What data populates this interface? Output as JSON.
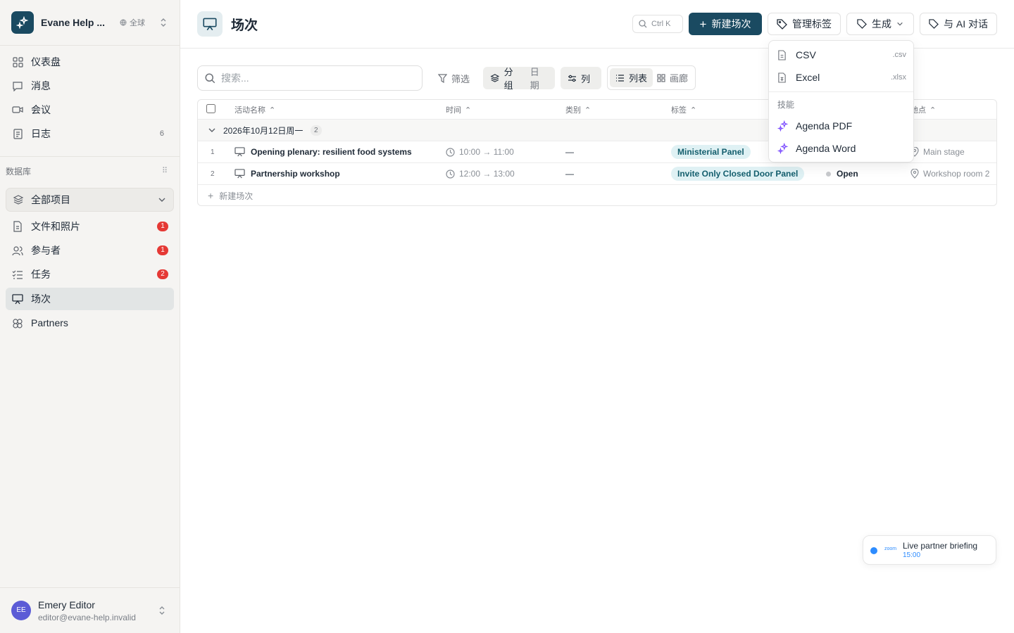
{
  "workspace": {
    "name": "Evane Help ...",
    "scope": "全球"
  },
  "nav": {
    "dashboard": "仪表盘",
    "messages": "消息",
    "meetings": "会议",
    "journal": "日志",
    "journal_count": "6"
  },
  "database": {
    "label": "数据库",
    "selector": "全部项目",
    "items": [
      {
        "label": "文件和照片",
        "badge": "1"
      },
      {
        "label": "参与者",
        "badge": "1"
      },
      {
        "label": "任务",
        "badge": "2"
      },
      {
        "label": "场次",
        "badge": ""
      },
      {
        "label": "Partners",
        "badge": ""
      }
    ]
  },
  "user": {
    "initials": "EE",
    "name": "Emery Editor",
    "email": "editor@evane-help.invalid"
  },
  "header": {
    "title": "场次",
    "shortcut": "Ctrl K",
    "new_button": "新建场次",
    "tags_button": "管理标签",
    "generate_button": "生成",
    "ai_button": "与 AI 对话"
  },
  "generate_menu": {
    "items": [
      {
        "label": "CSV",
        "suffix": ".csv"
      },
      {
        "label": "Excel",
        "suffix": ".xlsx"
      }
    ],
    "group_label": "技能",
    "skills": [
      {
        "label": "Agenda PDF"
      },
      {
        "label": "Agenda Word"
      }
    ]
  },
  "toolbar": {
    "search_placeholder": "搜索...",
    "filter": "筛选",
    "group": "分组",
    "group_value": "日期",
    "columns": "列",
    "view_list": "列表",
    "view_gallery": "画廊"
  },
  "table": {
    "columns": {
      "name": "活动名称",
      "time": "时间",
      "category": "类别",
      "tags": "标签",
      "location": "地点"
    },
    "group": {
      "label": "2026年10月12日周一",
      "count": "2"
    },
    "rows": [
      {
        "num": "1",
        "name": "Opening plenary: resilient food systems",
        "time": "10:00 → 11:00",
        "category": "—",
        "tag": "Ministerial Panel",
        "status": "",
        "location": "Main stage"
      },
      {
        "num": "2",
        "name": "Partnership workshop",
        "time": "12:00 → 13:00",
        "category": "—",
        "tag": "Invite Only Closed Door Panel",
        "status": "Open",
        "location": "Workshop room 2"
      }
    ],
    "add_label": "新建场次"
  },
  "live": {
    "zoom": "zoom",
    "title": "Live partner briefing",
    "time": "15:00"
  },
  "colors": {
    "accent": "#1a4a61",
    "badge": "#e53935",
    "tag_bg": "#dff1f4",
    "zoom": "#2d8cff",
    "skill_icon": "#7c4dff"
  }
}
